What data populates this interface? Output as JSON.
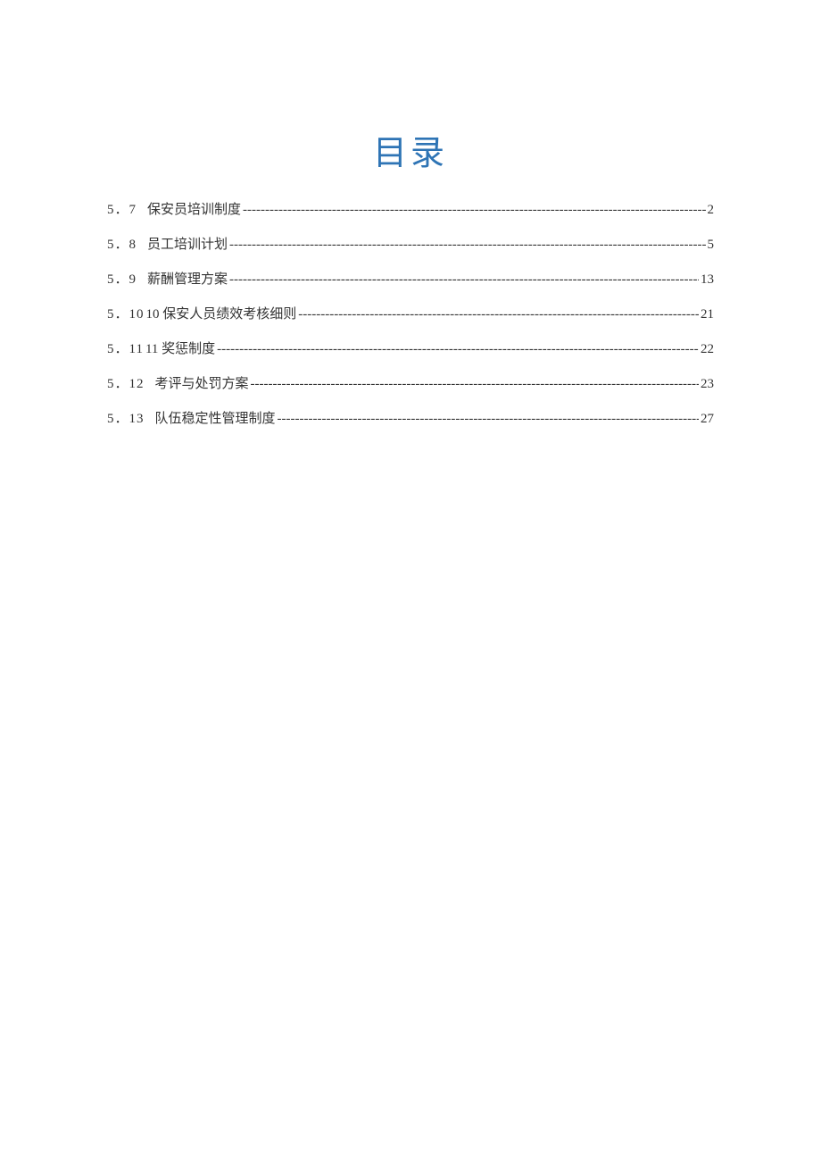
{
  "title": "目录",
  "toc": [
    {
      "number": "5．7",
      "label": "保安员培训制度",
      "page": "2",
      "tight": false
    },
    {
      "number": "5．8",
      "label": "员工培训计划",
      "page": "5",
      "tight": false
    },
    {
      "number": "5．9",
      "label": "薪酬管理方案",
      "page": "13",
      "tight": false
    },
    {
      "number": "5．10",
      "label": "10 保安人员绩效考核细则",
      "page": "21",
      "tight": true
    },
    {
      "number": "5．11",
      "label": "11 奖惩制度",
      "page": "22",
      "tight": true
    },
    {
      "number": "5．12",
      "label": "考评与处罚方案",
      "page": "23",
      "tight": false
    },
    {
      "number": "5．13",
      "label": "队伍稳定性管理制度",
      "page": "27",
      "tight": false
    }
  ],
  "leader": "--------------------------------------------------------------------------------------------------------------------------"
}
